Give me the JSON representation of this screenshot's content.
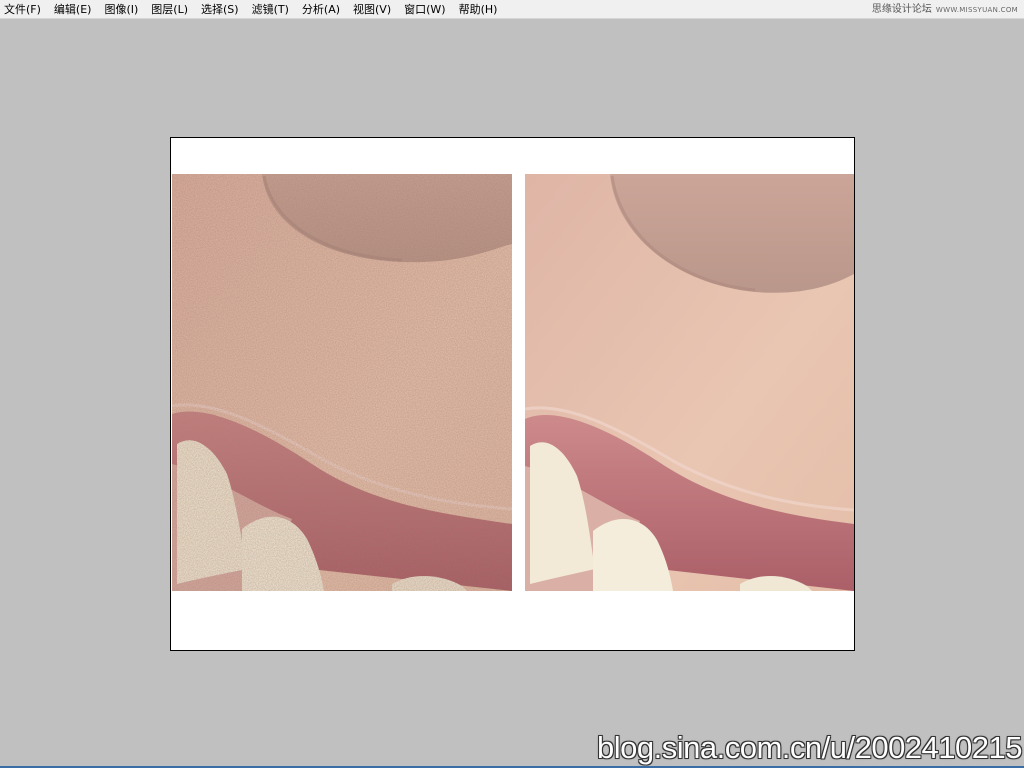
{
  "menubar": {
    "items": [
      {
        "label": "文件(F)"
      },
      {
        "label": "编辑(E)"
      },
      {
        "label": "图像(I)"
      },
      {
        "label": "图层(L)"
      },
      {
        "label": "选择(S)"
      },
      {
        "label": "滤镜(T)"
      },
      {
        "label": "分析(A)"
      },
      {
        "label": "视图(V)"
      },
      {
        "label": "窗口(W)"
      },
      {
        "label": "帮助(H)"
      }
    ],
    "site_name": "思缘设计论坛",
    "site_url": "WWW.MISSYUAN.COM"
  },
  "watermark": {
    "text": "blog.sina.com.cn/u/2002410215"
  },
  "colors": {
    "workspace": "#c0c0c0",
    "canvas": "#ffffff",
    "skin": "#e2b9a7",
    "lip": "#b8646c",
    "teeth": "#f1e9d4"
  }
}
